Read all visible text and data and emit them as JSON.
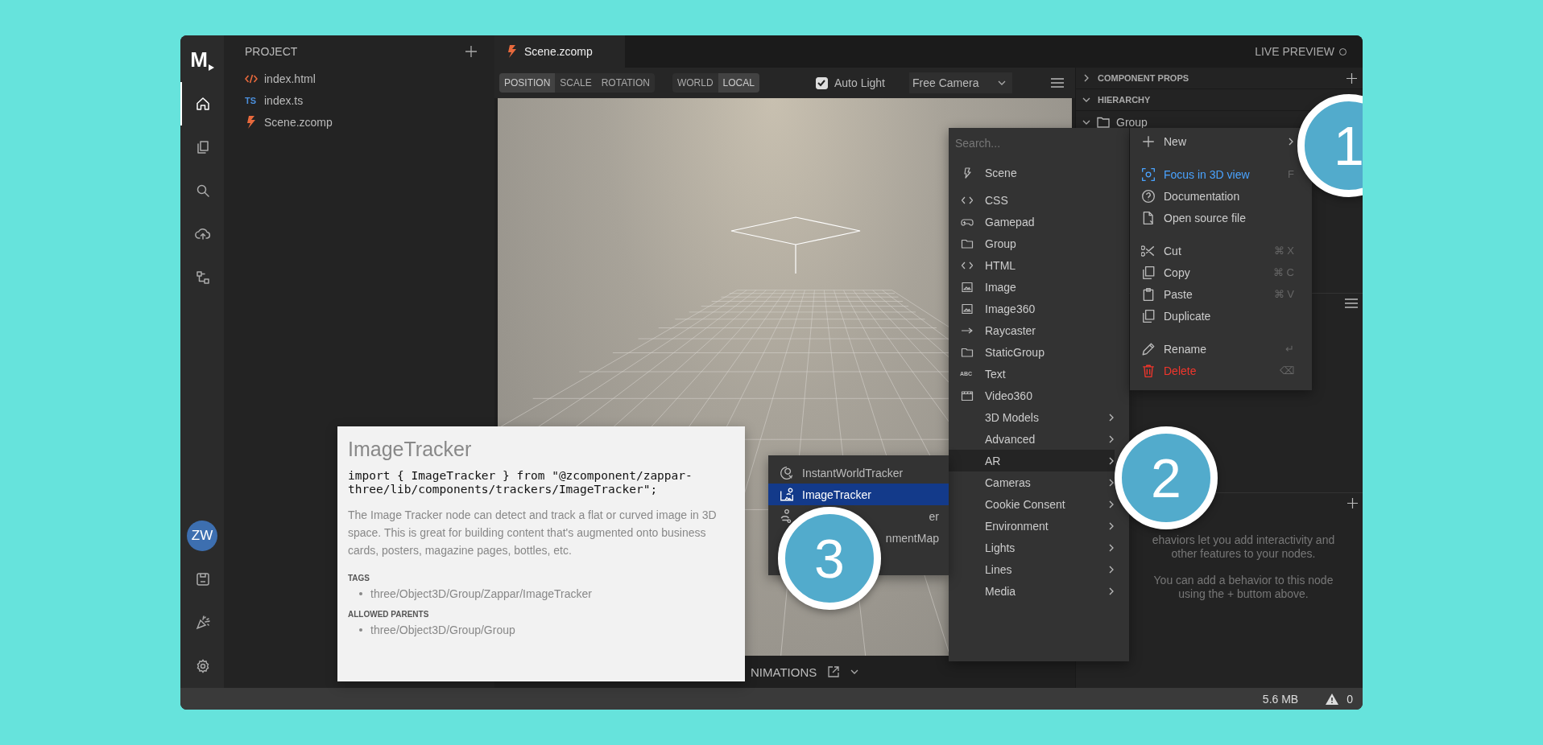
{
  "rail": {
    "logo": "M",
    "avatar": "ZW",
    "items": [
      {
        "selected": true
      },
      {
        "selected": false
      },
      {
        "selected": false
      },
      {
        "selected": false
      },
      {
        "selected": false
      }
    ]
  },
  "project": {
    "title": "PROJECT",
    "files": [
      {
        "name": "index.html",
        "kind": "html"
      },
      {
        "name": "index.ts",
        "kind": "ts",
        "badge": "TS"
      },
      {
        "name": "Scene.zcomp",
        "kind": "zcomp"
      }
    ]
  },
  "tab": {
    "label": "Scene.zcomp",
    "selected": true
  },
  "live_preview": {
    "label": "LIVE PREVIEW",
    "on": false
  },
  "toolbar": {
    "transform_modes": [
      {
        "label": "POSITION",
        "selected": true
      },
      {
        "label": "SCALE",
        "selected": false
      },
      {
        "label": "ROTATION",
        "selected": false
      }
    ],
    "spaces": [
      {
        "label": "WORLD",
        "selected": false
      },
      {
        "label": "LOCAL",
        "selected": true
      }
    ],
    "auto_light": {
      "label": "Auto Light",
      "checked": true
    },
    "camera_select": {
      "value": "Free Camera"
    }
  },
  "right_panel": {
    "component_props": {
      "title": "COMPONENT PROPS",
      "expanded": false
    },
    "hierarchy": {
      "title": "HIERARCHY",
      "expanded": true,
      "nodes": [
        {
          "name": "Group",
          "expanded": true
        }
      ]
    },
    "behaviors": {
      "paragraphs": [
        [
          "ehaviors let you add interactivity and",
          "other features to your nodes."
        ],
        [
          "You can add a behavior to this node",
          "using the + buttom above."
        ]
      ]
    }
  },
  "bottom_bar": {
    "label": "NIMATIONS"
  },
  "status_bar": {
    "memory": "5.6 MB",
    "warnings": "0"
  },
  "new_menu": {
    "placeholder": "Search...",
    "groups": [
      [
        {
          "label": "Scene",
          "kind": "node",
          "selected": false
        }
      ],
      [
        {
          "label": "CSS",
          "kind": "node",
          "selected": false
        },
        {
          "label": "Gamepad",
          "kind": "node",
          "selected": false
        },
        {
          "label": "Group",
          "kind": "node",
          "selected": false
        },
        {
          "label": "HTML",
          "kind": "node",
          "selected": false
        },
        {
          "label": "Image",
          "kind": "node",
          "selected": false
        },
        {
          "label": "Image360",
          "kind": "node",
          "selected": false
        },
        {
          "label": "Raycaster",
          "kind": "node",
          "selected": false
        },
        {
          "label": "StaticGroup",
          "kind": "node",
          "selected": false
        },
        {
          "label": "Text",
          "kind": "node",
          "badge": "ABC",
          "selected": false
        },
        {
          "label": "Video360",
          "kind": "node",
          "selected": false
        },
        {
          "label": "3D Models",
          "kind": "folder",
          "selected": false
        },
        {
          "label": "Advanced",
          "kind": "folder",
          "selected": false
        },
        {
          "label": "AR",
          "kind": "folder",
          "selected": true
        },
        {
          "label": "Cameras",
          "kind": "folder",
          "selected": false
        },
        {
          "label": "Cookie Consent",
          "kind": "folder",
          "selected": false
        },
        {
          "label": "Environment",
          "kind": "folder",
          "selected": false
        },
        {
          "label": "Lights",
          "kind": "folder",
          "selected": false
        },
        {
          "label": "Lines",
          "kind": "folder",
          "selected": false
        },
        {
          "label": "Media",
          "kind": "folder",
          "selected": false
        }
      ]
    ]
  },
  "context_menu": {
    "groups": [
      [
        {
          "label": "New",
          "kind": "submenu"
        }
      ],
      [
        {
          "label": "Focus in 3D view",
          "kind": "accent",
          "shortcut": "F"
        },
        {
          "label": "Documentation",
          "kind": "normal"
        },
        {
          "label": "Open source file",
          "kind": "normal"
        }
      ],
      [
        {
          "label": "Cut",
          "kind": "normal",
          "shortcut": "⌘ X"
        },
        {
          "label": "Copy",
          "kind": "normal",
          "shortcut": "⌘ C"
        },
        {
          "label": "Paste",
          "kind": "normal",
          "shortcut": "⌘ V"
        },
        {
          "label": "Duplicate",
          "kind": "normal"
        }
      ],
      [
        {
          "label": "Rename",
          "kind": "normal",
          "shortcut": "↵"
        },
        {
          "label": "Delete",
          "kind": "danger",
          "shortcut": "⌫"
        }
      ]
    ]
  },
  "ar_submenu": {
    "items": [
      {
        "label": "InstantWorldTracker",
        "kind": "full",
        "selected": false
      },
      {
        "label": "ImageTracker",
        "kind": "full",
        "selected": true
      },
      {
        "label": "er",
        "kind": "partial",
        "selected": false
      },
      {
        "label": "nmentMap",
        "kind": "partial",
        "selected": false
      }
    ]
  },
  "doc_tooltip": {
    "title": "ImageTracker",
    "code": "import { ImageTracker } from \"@zcomponent/zappar-three/lib/components/trackers/ImageTracker\";",
    "description": "The Image Tracker node can detect and track a flat or curved image in 3D space. This is great for building content that's augmented onto business cards, posters, magazine pages, bottles, etc.",
    "sections": [
      {
        "heading": "TAGS",
        "items": [
          "three/Object3D/Group/Zappar/ImageTracker"
        ]
      },
      {
        "heading": "ALLOWED PARENTS",
        "items": [
          "three/Object3D/Group/Group"
        ]
      }
    ]
  },
  "callouts": [
    {
      "number": "1"
    },
    {
      "number": "2"
    },
    {
      "number": "3"
    }
  ]
}
